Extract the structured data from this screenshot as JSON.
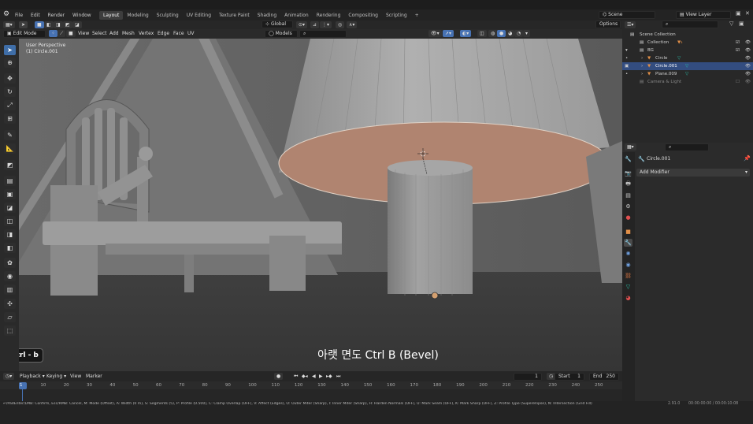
{
  "menus": [
    "File",
    "Edit",
    "Render",
    "Window",
    "Help"
  ],
  "workspaces": [
    {
      "label": "Layout",
      "active": true
    },
    {
      "label": "Modeling"
    },
    {
      "label": "Sculpting"
    },
    {
      "label": "UV Editing"
    },
    {
      "label": "Texture Paint"
    },
    {
      "label": "Shading"
    },
    {
      "label": "Animation"
    },
    {
      "label": "Rendering"
    },
    {
      "label": "Compositing"
    },
    {
      "label": "Scripting"
    }
  ],
  "scene": {
    "label": "Scene"
  },
  "view_layer": {
    "label": "View Layer"
  },
  "viewport_header": {
    "mode": "Edit Mode",
    "menus": [
      "View",
      "Select",
      "Add",
      "Mesh",
      "Vertex",
      "Edge",
      "Face",
      "UV"
    ],
    "orientation": "Global",
    "pivot": "Models",
    "options": "Options"
  },
  "viewport": {
    "perspective": "User Perspective",
    "object": "(1) Circle.001",
    "key_hint": "Ctrl - b",
    "caption": "아랫 면도 Ctrl B (Bevel)"
  },
  "outliner": {
    "items": [
      {
        "label": "Scene Collection",
        "indent": 0
      },
      {
        "label": "Collection",
        "indent": 1
      },
      {
        "label": "BG",
        "indent": 1
      },
      {
        "label": "Circle",
        "indent": 2
      },
      {
        "label": "Circle.001",
        "indent": 2,
        "selected": true
      },
      {
        "label": "Plane.009",
        "indent": 2
      },
      {
        "label": "Camera & Light",
        "indent": 1,
        "dim": true
      }
    ]
  },
  "properties": {
    "object_name": "Circle.001",
    "add_modifier": "Add Modifier"
  },
  "timeline": {
    "menus": [
      "Playback",
      "Keying",
      "View",
      "Marker"
    ],
    "current_frame": "1",
    "start_label": "Start",
    "start": "1",
    "end_label": "End",
    "end": "250",
    "ticks": [
      "1",
      "10",
      "20",
      "30",
      "40",
      "50",
      "60",
      "70",
      "80",
      "90",
      "100",
      "110",
      "120",
      "130",
      "140",
      "150",
      "160",
      "170",
      "180",
      "190",
      "200",
      "210",
      "220",
      "230",
      "240",
      "250"
    ]
  },
  "status": {
    "hint": "↵/PadEnter/LMB: Confirm, Esc/RMB: Cancel, M: Mode (Offset), A: Width (0 m), S: Segments (5), P: Profile (0.500), C: Clamp Overlap (OFF), V: Affect (Edges), O: Outer Miter (Sharp), I: Inner Miter (Sharp), H: Harden Normals (OFF), U: Mark Seam (OFF), K: Mark Sharp (OFF), Z: Profile Type (Superellipse), N: Intersection (Grid Fill)",
    "version": "2.91.0",
    "timecode": "00:00:00:00 / 00:00:10:08"
  },
  "colors": {
    "accent": "#4772b3",
    "selected_row": "#334d80",
    "face_select": "#b08470"
  }
}
